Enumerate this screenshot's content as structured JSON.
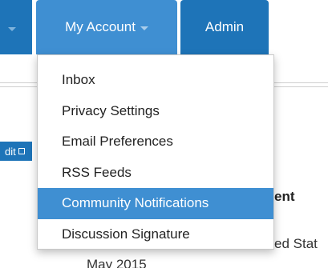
{
  "nav": {
    "tabs": [
      {
        "label": ""
      },
      {
        "label": "My Account"
      },
      {
        "label": "Admin"
      }
    ],
    "active_color": "#3f8fd2",
    "tab_color": "#1e74b8"
  },
  "dropdown": {
    "items": [
      {
        "label": "Inbox"
      },
      {
        "label": "Privacy Settings"
      },
      {
        "label": "Email Preferences"
      },
      {
        "label": "RSS Feeds"
      },
      {
        "label": "Community Notifications",
        "highlighted": true
      },
      {
        "label": "Discussion Signature"
      }
    ]
  },
  "background": {
    "edit_label": "dit",
    "heading_fragment": "ent",
    "country_fragment": "ed Stat",
    "date_fragment": "May 2015"
  }
}
